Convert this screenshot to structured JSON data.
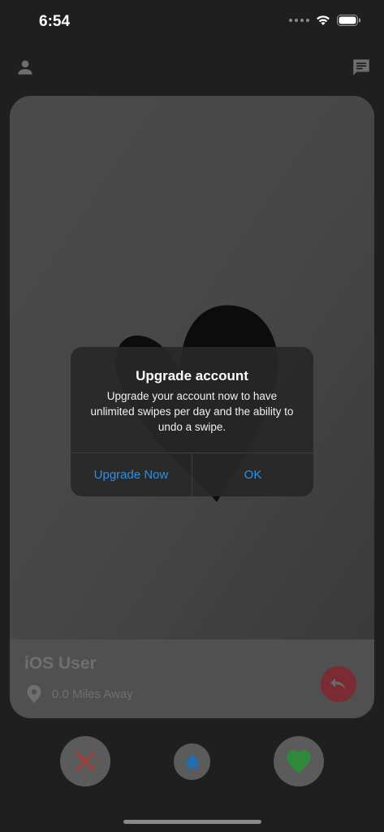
{
  "status_bar": {
    "time": "6:54"
  },
  "card": {
    "name": "iOS User",
    "distance": "0.0 Miles Away"
  },
  "alert": {
    "title": "Upgrade account",
    "message": "Upgrade your account now to have unlimited swipes per day and the ability to undo a swipe.",
    "buttons": {
      "upgrade_label": "Upgrade Now",
      "ok_label": "OK"
    }
  },
  "icons": {
    "profile": "person-icon",
    "messages": "chat-icon",
    "location": "location-pin-icon",
    "undo": "undo-icon",
    "dislike": "x-icon",
    "superlike": "star-icon",
    "like": "heart-icon"
  },
  "colors": {
    "accent_blue": "#2f8fe0",
    "dislike_red": "#a83a3a",
    "superlike_blue": "#1f6fb8",
    "like_green": "#2e8a3a",
    "undo_red": "#7b2b32"
  }
}
